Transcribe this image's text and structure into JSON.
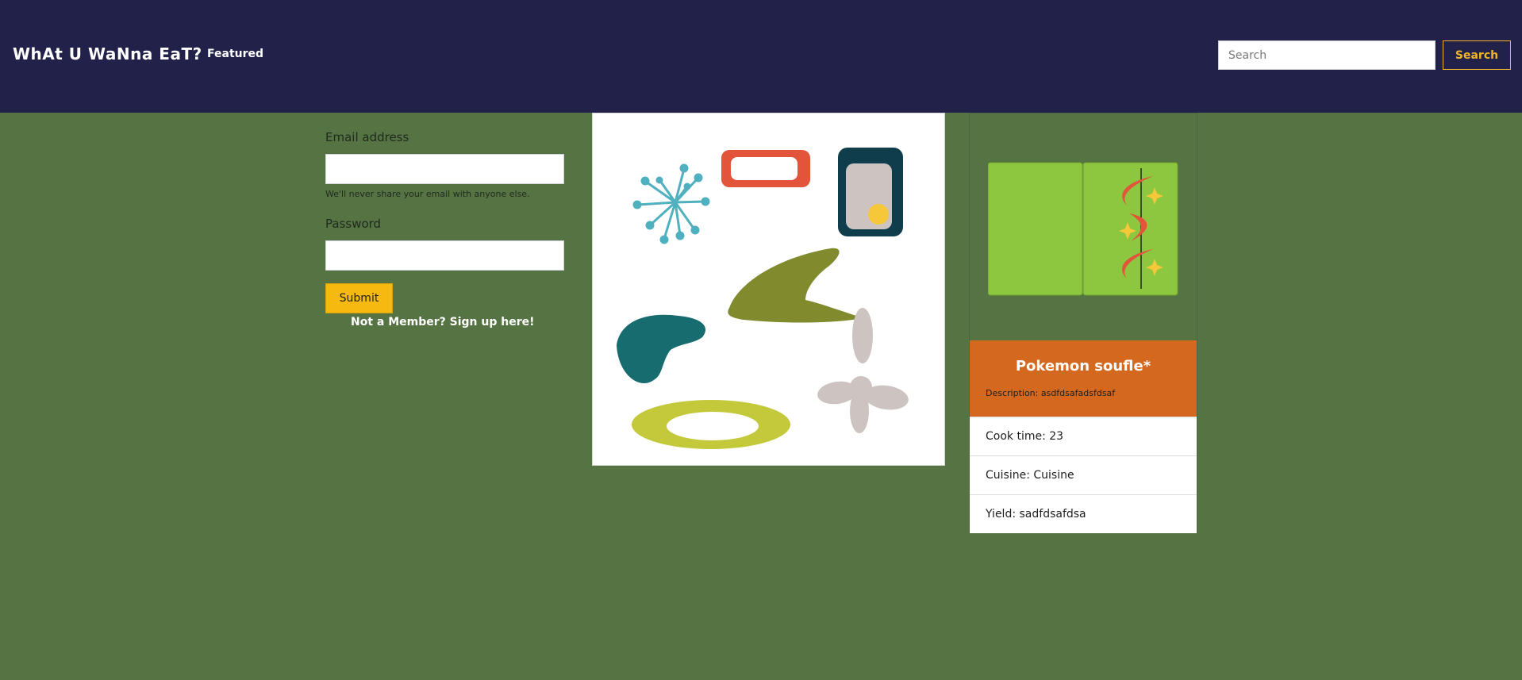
{
  "navbar": {
    "brand": "WhAt U WaNna EaT?",
    "links": [
      "Featured"
    ],
    "search_placeholder": "Search",
    "search_button": "Search"
  },
  "login": {
    "email_label": "Email address",
    "email_value": "",
    "email_help": "We'll never share your email with anyone else.",
    "password_label": "Password",
    "password_value": "",
    "submit_label": "Submit",
    "signup_link": "Not a Member? Sign up here!"
  },
  "recipe": {
    "title": "Pokemon soufle*",
    "description": "Description: asdfdsafadsfdsaf",
    "cook_time": "Cook time: 23",
    "cuisine": "Cuisine: Cuisine",
    "yield": "Yield: sadfdsafdsa"
  },
  "colors": {
    "navbar": "#21214a",
    "background": "#567343",
    "accent": "#f0b429",
    "card_header": "#d4681f"
  }
}
